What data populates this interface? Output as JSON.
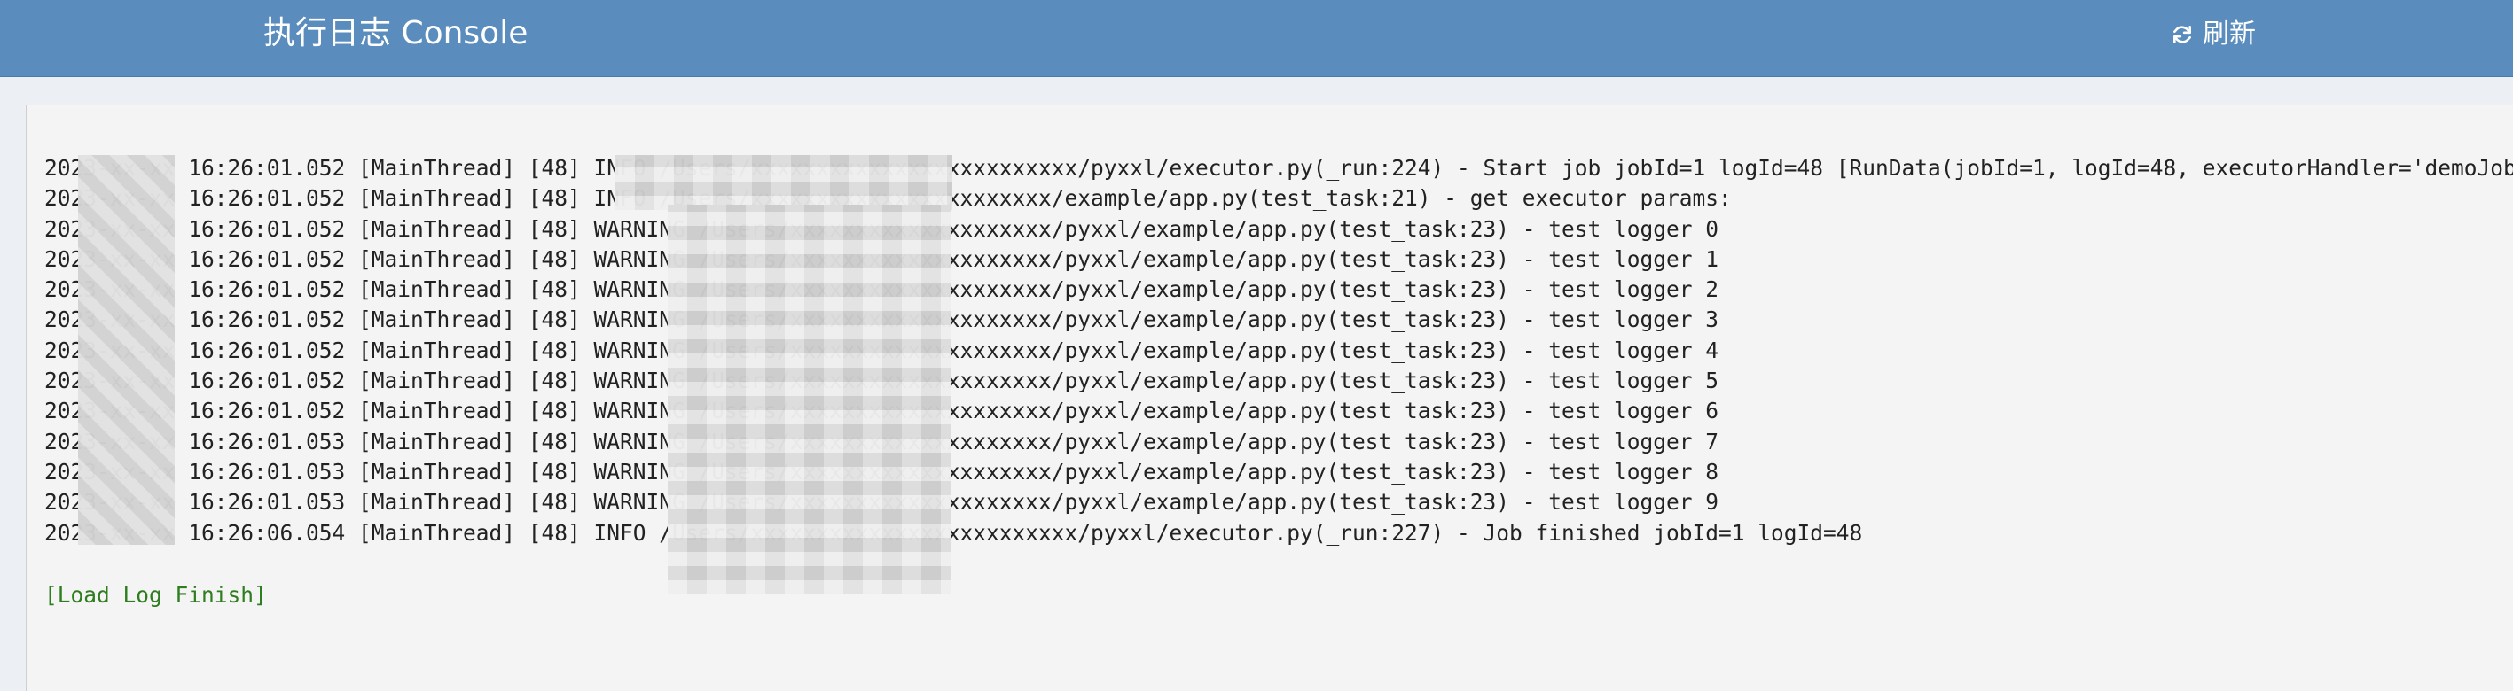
{
  "header": {
    "title": "执行日志 Console",
    "refresh_icon": "refresh-icon",
    "refresh_label": "刷新"
  },
  "console": {
    "lines": [
      "2023-xx-xx 16:26:01.052 [MainThread] [48] INFO /Users/xxxxxxxxxxxxxxxxxxxxxxxxx/pyxxl/executor.py(_run:224) - Start job jobId=1 logId=48 [RunData(jobId=1, logId=48, executorHandler='demoJobHandler', executorParams=",
      "2023-xx-xx 16:26:01.052 [MainThread] [48] INFO /Users/xxxxxxxxxxxxxxxxxxxxxxx/example/app.py(test_task:21) - get executor params:",
      "2023-xx-xx 16:26:01.052 [MainThread] [48] WARNING /Users/xxxxxxxxxxxxxxxxxxxx/pyxxl/example/app.py(test_task:23) - test logger 0",
      "2023-xx-xx 16:26:01.052 [MainThread] [48] WARNING /Users/xxxxxxxxxxxxxxxxxxxx/pyxxl/example/app.py(test_task:23) - test logger 1",
      "2023-xx-xx 16:26:01.052 [MainThread] [48] WARNING /Users/xxxxxxxxxxxxxxxxxxxx/pyxxl/example/app.py(test_task:23) - test logger 2",
      "2023-xx-xx 16:26:01.052 [MainThread] [48] WARNING /Users/xxxxxxxxxxxxxxxxxxxx/pyxxl/example/app.py(test_task:23) - test logger 3",
      "2023-xx-xx 16:26:01.052 [MainThread] [48] WARNING /Users/xxxxxxxxxxxxxxxxxxxx/pyxxl/example/app.py(test_task:23) - test logger 4",
      "2023-xx-xx 16:26:01.052 [MainThread] [48] WARNING /Users/xxxxxxxxxxxxxxxxxxxx/pyxxl/example/app.py(test_task:23) - test logger 5",
      "2023-xx-xx 16:26:01.052 [MainThread] [48] WARNING /Users/xxxxxxxxxxxxxxxxxxxx/pyxxl/example/app.py(test_task:23) - test logger 6",
      "2023-xx-xx 16:26:01.053 [MainThread] [48] WARNING /Users/xxxxxxxxxxxxxxxxxxxx/pyxxl/example/app.py(test_task:23) - test logger 7",
      "2023-xx-xx 16:26:01.053 [MainThread] [48] WARNING /Users/xxxxxxxxxxxxxxxxxxxx/pyxxl/example/app.py(test_task:23) - test logger 8",
      "2023-xx-xx 16:26:01.053 [MainThread] [48] WARNING /Users/xxxxxxxxxxxxxxxxxxxx/pyxxl/example/app.py(test_task:23) - test logger 9",
      "2023-xx-xx 16:26:06.054 [MainThread] [48] INFO /Users/xxxxxxxxxxxxxxxxxxxxxxxxx/pyxxl/executor.py(_run:227) - Job finished jobId=1 logId=48"
    ],
    "finish_text": "[Load Log Finish]"
  },
  "colors": {
    "header_bg": "#5a8dbd",
    "console_bg": "#f4f4f4",
    "log_text": "#222222",
    "finish_text": "#2e7d1f"
  }
}
